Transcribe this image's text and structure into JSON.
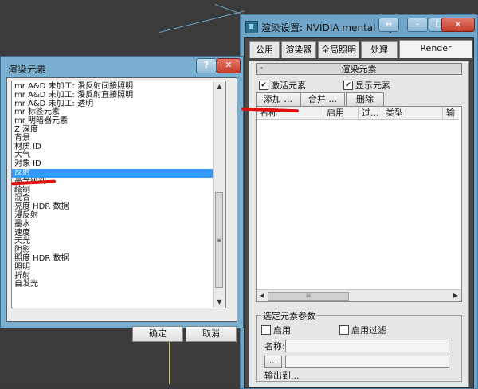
{
  "render_setup": {
    "title": "渲染设置: NVIDIA mental ray",
    "restore_icon": "⇔",
    "minimize_icon": "–",
    "maximize_icon": "□",
    "close_icon": "✕",
    "tabs": [
      "公用",
      "渲染器",
      "全局照明",
      "处理",
      "Render Elements"
    ],
    "rollout": {
      "collapse_symbol": "-",
      "title": "渲染元素",
      "activate_elements": "激活元素",
      "display_elements": "显示元素",
      "add_button": "添加 ...",
      "merge_button": "合并 ...",
      "delete_button": "删除",
      "columns": [
        "名称",
        "启用",
        "过...",
        "类型",
        "输"
      ]
    },
    "params": {
      "group_title": "选定元素参数",
      "enable": "启用",
      "enable_filter": "启用过滤",
      "name_label": "名称:",
      "browse_button": "...",
      "next_label": "输出到..."
    }
  },
  "dialog": {
    "title": "渲染元素",
    "help_icon": "?",
    "close_icon": "✕",
    "items": [
      "mr A&D 未加工: 漫反射间接照明",
      "mr A&D 未加工: 漫反射直接照明",
      "mr A&D 未加工: 透明",
      "mr 标签元素",
      "mr 明暗器元素",
      "Z 深度",
      "背景",
      "材质 ID",
      "大气",
      "对象 ID",
      "反射",
      "高光级别",
      "绘制",
      "混合",
      "亮度 HDR 数据",
      "漫反射",
      "墨水",
      "速度",
      "天光",
      "阴影",
      "照度 HDR 数据",
      "照明",
      "折射",
      "自发光"
    ],
    "selected_index": 10,
    "ok_button": "确定",
    "cancel_button": "取消"
  }
}
